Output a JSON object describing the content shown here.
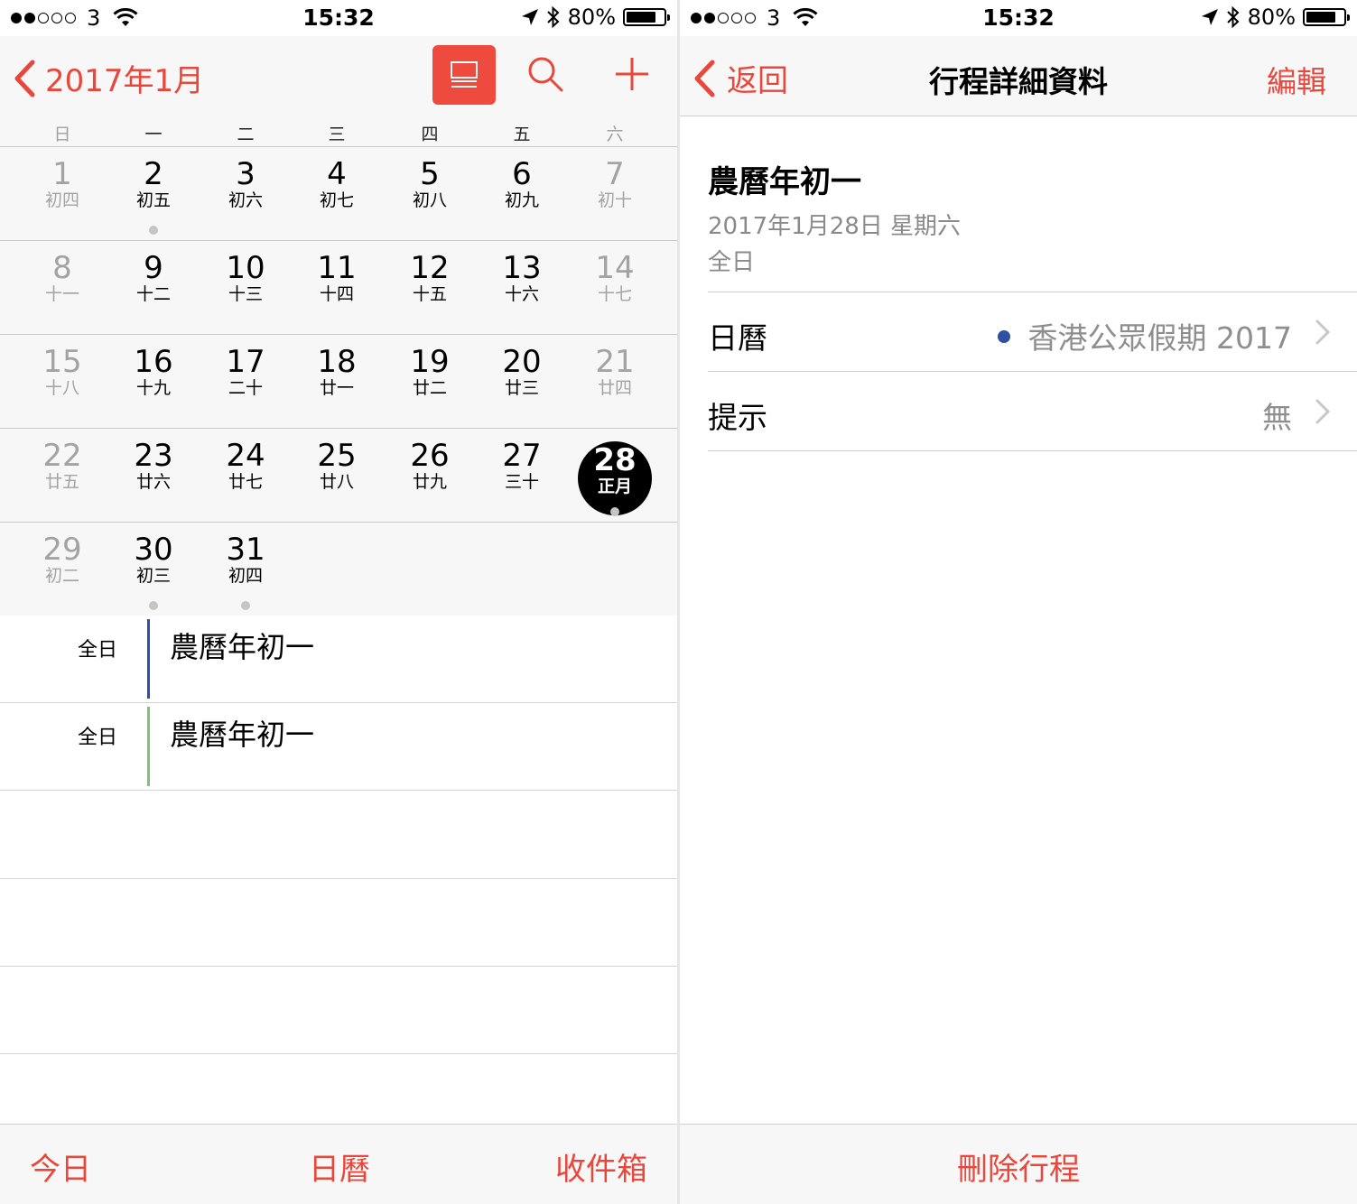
{
  "colors": {
    "accent": "#e8473c",
    "event_blue": "#2f4fa3",
    "event_green": "#7cc576",
    "selected": "#000000"
  },
  "left": {
    "status": {
      "carrier": "3",
      "time": "15:32",
      "battery": "80%",
      "battery_level": 0.8
    },
    "nav": {
      "back_label": "2017年1月",
      "icons": [
        "chevron-left-icon",
        "list-view-icon",
        "search-icon",
        "plus-icon"
      ]
    },
    "weekdays": [
      "日",
      "一",
      "二",
      "三",
      "四",
      "五",
      "六"
    ],
    "weeks": [
      [
        {
          "day": "1",
          "lunar": "初四"
        },
        {
          "day": "2",
          "lunar": "初五",
          "dot": true
        },
        {
          "day": "3",
          "lunar": "初六"
        },
        {
          "day": "4",
          "lunar": "初七"
        },
        {
          "day": "5",
          "lunar": "初八"
        },
        {
          "day": "6",
          "lunar": "初九"
        },
        {
          "day": "7",
          "lunar": "初十"
        }
      ],
      [
        {
          "day": "8",
          "lunar": "十一"
        },
        {
          "day": "9",
          "lunar": "十二"
        },
        {
          "day": "10",
          "lunar": "十三"
        },
        {
          "day": "11",
          "lunar": "十四"
        },
        {
          "day": "12",
          "lunar": "十五"
        },
        {
          "day": "13",
          "lunar": "十六"
        },
        {
          "day": "14",
          "lunar": "十七"
        }
      ],
      [
        {
          "day": "15",
          "lunar": "十八"
        },
        {
          "day": "16",
          "lunar": "十九"
        },
        {
          "day": "17",
          "lunar": "二十"
        },
        {
          "day": "18",
          "lunar": "廿一"
        },
        {
          "day": "19",
          "lunar": "廿二"
        },
        {
          "day": "20",
          "lunar": "廿三"
        },
        {
          "day": "21",
          "lunar": "廿四"
        }
      ],
      [
        {
          "day": "22",
          "lunar": "廿五"
        },
        {
          "day": "23",
          "lunar": "廿六"
        },
        {
          "day": "24",
          "lunar": "廿七"
        },
        {
          "day": "25",
          "lunar": "廿八"
        },
        {
          "day": "26",
          "lunar": "廿九"
        },
        {
          "day": "27",
          "lunar": "三十"
        },
        {
          "day": "28",
          "lunar": "正月",
          "selected": true,
          "dot": true
        }
      ],
      [
        {
          "day": "29",
          "lunar": "初二"
        },
        {
          "day": "30",
          "lunar": "初三",
          "dot": true
        },
        {
          "day": "31",
          "lunar": "初四",
          "dot": true
        }
      ]
    ],
    "events": [
      {
        "time": "全日",
        "title": "農曆年初一",
        "color": "#2f4fa3"
      },
      {
        "time": "全日",
        "title": "農曆年初一",
        "color": "#7cc576"
      }
    ],
    "tabs": [
      "今日",
      "日曆",
      "收件箱"
    ]
  },
  "right": {
    "status": {
      "carrier": "3",
      "time": "15:32",
      "battery": "80%",
      "battery_level": 0.8
    },
    "nav": {
      "back_label": "返回",
      "title": "行程詳細資料",
      "edit_label": "編輯"
    },
    "event": {
      "title": "農曆年初一",
      "date": "2017年1月28日 星期六",
      "time": "全日"
    },
    "rows": [
      {
        "label": "日曆",
        "value": "香港公眾假期 2017",
        "dot_color": "#2f4fa3"
      },
      {
        "label": "提示",
        "value": "無"
      }
    ],
    "delete_label": "刪除行程"
  }
}
